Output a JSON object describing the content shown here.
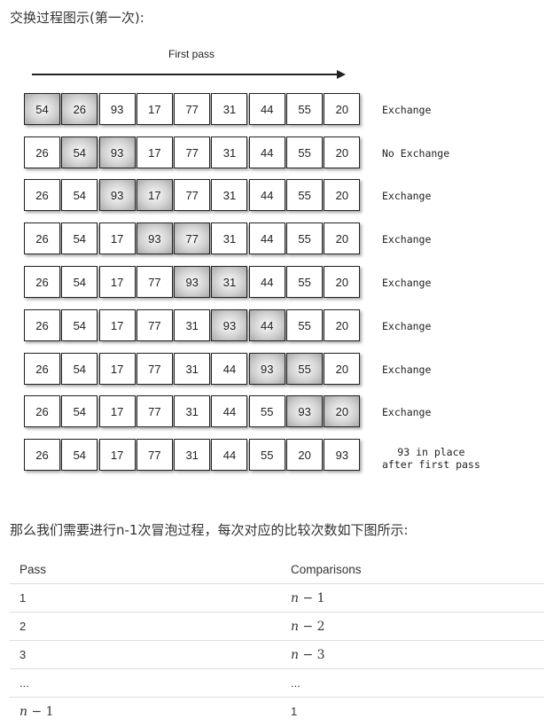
{
  "intro": "交换过程图示(第一次):",
  "figure": {
    "pass_title": "First pass",
    "rows": [
      {
        "values": [
          "54",
          "26",
          "93",
          "17",
          "77",
          "31",
          "44",
          "55",
          "20"
        ],
        "highlight": [
          0,
          1
        ],
        "label": "Exchange"
      },
      {
        "values": [
          "26",
          "54",
          "93",
          "17",
          "77",
          "31",
          "44",
          "55",
          "20"
        ],
        "highlight": [
          1,
          2
        ],
        "label": "No Exchange"
      },
      {
        "values": [
          "26",
          "54",
          "93",
          "17",
          "77",
          "31",
          "44",
          "55",
          "20"
        ],
        "highlight": [
          2,
          3
        ],
        "label": "Exchange"
      },
      {
        "values": [
          "26",
          "54",
          "17",
          "93",
          "77",
          "31",
          "44",
          "55",
          "20"
        ],
        "highlight": [
          3,
          4
        ],
        "label": "Exchange"
      },
      {
        "values": [
          "26",
          "54",
          "17",
          "77",
          "93",
          "31",
          "44",
          "55",
          "20"
        ],
        "highlight": [
          4,
          5
        ],
        "label": "Exchange"
      },
      {
        "values": [
          "26",
          "54",
          "17",
          "77",
          "31",
          "93",
          "44",
          "55",
          "20"
        ],
        "highlight": [
          5,
          6
        ],
        "label": "Exchange"
      },
      {
        "values": [
          "26",
          "54",
          "17",
          "77",
          "31",
          "44",
          "93",
          "55",
          "20"
        ],
        "highlight": [
          6,
          7
        ],
        "label": "Exchange"
      },
      {
        "values": [
          "26",
          "54",
          "17",
          "77",
          "31",
          "44",
          "55",
          "93",
          "20"
        ],
        "highlight": [
          7,
          8
        ],
        "label": "Exchange"
      },
      {
        "values": [
          "26",
          "54",
          "17",
          "77",
          "31",
          "44",
          "55",
          "20",
          "93"
        ],
        "highlight": [],
        "label": "93 in place\nafter first pass"
      }
    ]
  },
  "paragraph": "那么我们需要进行n-1次冒泡过程，每次对应的比较次数如下图所示:",
  "table": {
    "headers": [
      "Pass",
      "Comparisons"
    ],
    "rows": [
      [
        "1",
        "n − 1"
      ],
      [
        "2",
        "n − 2"
      ],
      [
        "3",
        "n − 3"
      ],
      [
        "...",
        "..."
      ],
      [
        "n − 1",
        "1"
      ]
    ]
  }
}
